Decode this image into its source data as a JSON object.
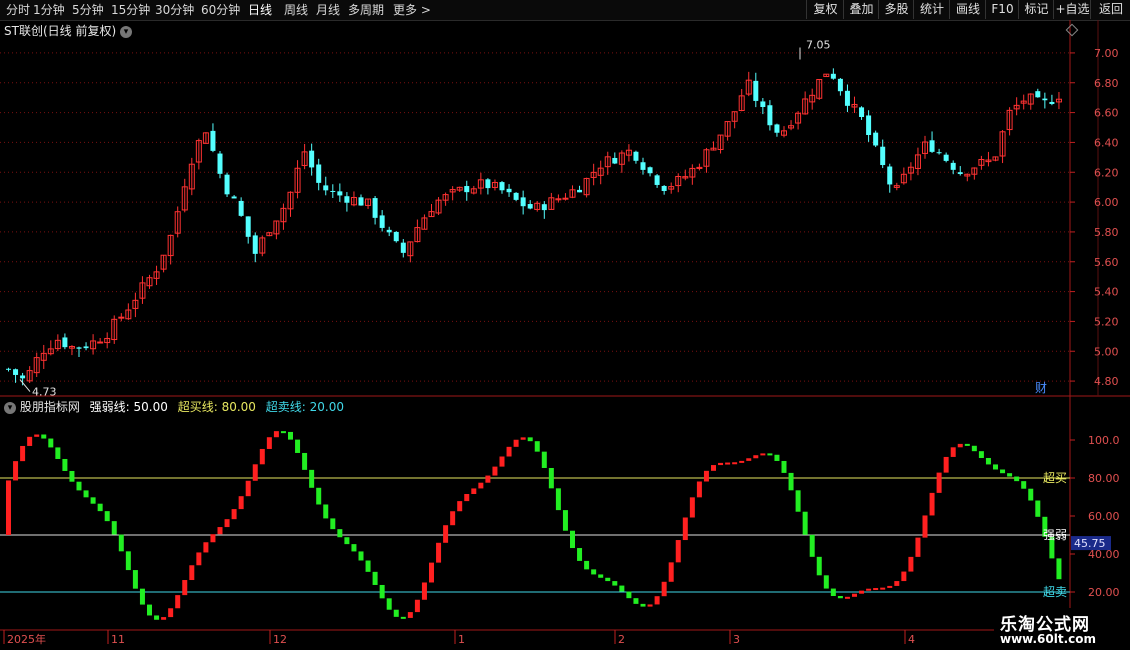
{
  "toolbar": {
    "periods": [
      "分时",
      "1分钟",
      "5分钟",
      "15分钟",
      "30分钟",
      "60分钟",
      "日线",
      "周线",
      "月线",
      "多周期",
      "更多 >"
    ],
    "active_period": "日线",
    "buttons": [
      "复权",
      "叠加",
      "多股",
      "统计",
      "画线",
      "F10",
      "标记",
      "+自选",
      "返回"
    ]
  },
  "upper": {
    "title": "ST联创(日线 前复权)",
    "high_marker": "7.05",
    "low_marker": "4.73",
    "fin_badge": "财",
    "price_axis": [
      "7.00",
      "6.80",
      "6.60",
      "6.40",
      "6.20",
      "6.00",
      "5.80",
      "5.60",
      "5.40",
      "5.20",
      "5.00",
      "4.80"
    ]
  },
  "lower": {
    "indicator_name": "股朋指标网",
    "strong_weak_label": "强弱线: 50.00",
    "overbought_label": "超买线: 80.00",
    "oversold_label": "超卖线: 20.00",
    "axis": [
      "100.0",
      "80.00",
      "60.00",
      "40.00",
      "20.00"
    ],
    "line_tag_overbought": "超买",
    "line_tag_strongweak": "强弱",
    "line_tag_oversold": "超卖",
    "current_value": "45.75"
  },
  "date_axis": [
    "2025年",
    "11",
    "12",
    "1",
    "2",
    "3",
    "4"
  ],
  "watermark": {
    "line1": "乐淘公式网",
    "line2": "www.60lt.com"
  },
  "colors": {
    "up": "#ff3232",
    "down": "#54ffff",
    "ind_up": "#ff2020",
    "ind_down": "#22ee22",
    "overbought": "#e8e860",
    "oversold": "#40d8e8",
    "strongweak": "#e0e0e0",
    "grid": "#7a1010"
  }
}
